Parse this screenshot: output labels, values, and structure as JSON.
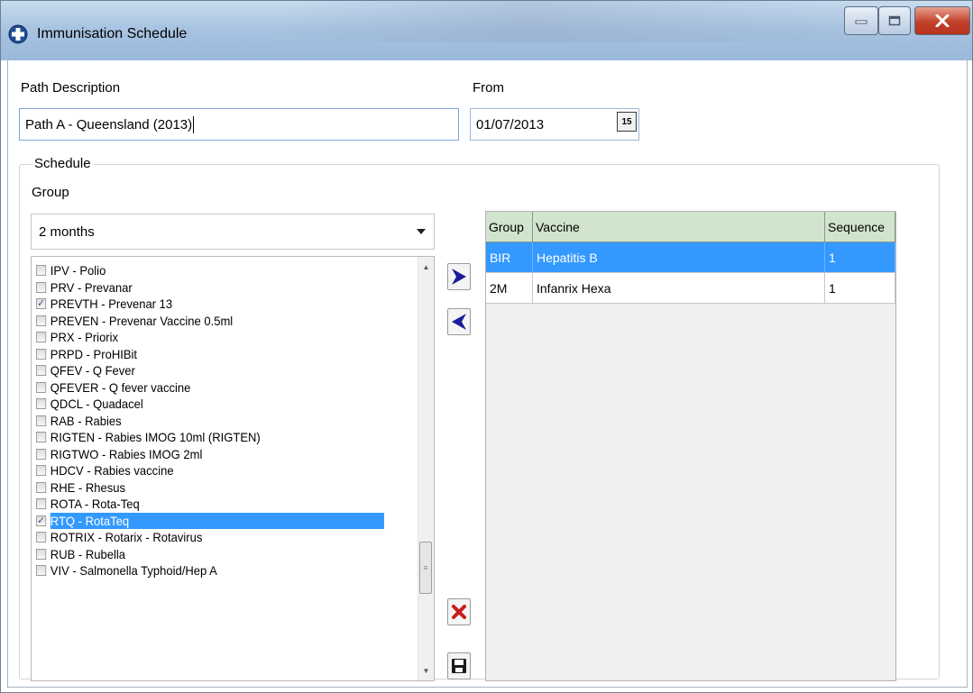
{
  "window": {
    "title": "Immunisation Schedule",
    "icon": "app-icon",
    "controls": [
      "minimize-icon",
      "maximize-icon",
      "close-icon"
    ]
  },
  "form": {
    "path_description_label": "Path Description",
    "path_description_value": "Path A - Queensland (2013)",
    "from_label": "From",
    "from_value": "01/07/2013",
    "calendar_button_text": "15"
  },
  "schedule": {
    "title": "Schedule",
    "group_label": "Group",
    "group_selected": "2 months",
    "vaccine_list": [
      {
        "label": "IPV - Polio",
        "checked": false,
        "selected": false
      },
      {
        "label": "PRV - Prevanar",
        "checked": false,
        "selected": false
      },
      {
        "label": "PREVTH - Prevenar 13",
        "checked": true,
        "selected": false
      },
      {
        "label": "PREVEN - Prevenar Vaccine 0.5ml",
        "checked": false,
        "selected": false
      },
      {
        "label": "PRX - Priorix",
        "checked": false,
        "selected": false
      },
      {
        "label": "PRPD - ProHIBit",
        "checked": false,
        "selected": false
      },
      {
        "label": "QFEV - Q Fever",
        "checked": false,
        "selected": false
      },
      {
        "label": "QFEVER - Q fever vaccine",
        "checked": false,
        "selected": false
      },
      {
        "label": "QDCL - Quadacel",
        "checked": false,
        "selected": false
      },
      {
        "label": "RAB - Rabies",
        "checked": false,
        "selected": false
      },
      {
        "label": "RIGTEN - Rabies IMOG 10ml (RIGTEN)",
        "checked": false,
        "selected": false
      },
      {
        "label": "RIGTWO - Rabies IMOG 2ml",
        "checked": false,
        "selected": false
      },
      {
        "label": "HDCV - Rabies vaccine",
        "checked": false,
        "selected": false
      },
      {
        "label": "RHE - Rhesus",
        "checked": false,
        "selected": false
      },
      {
        "label": "ROTA - Rota-Teq",
        "checked": false,
        "selected": false
      },
      {
        "label": "RTQ - RotaTeq",
        "checked": true,
        "selected": true
      },
      {
        "label": "ROTRIX - Rotarix - Rotavirus",
        "checked": false,
        "selected": false
      },
      {
        "label": "RUB - Rubella",
        "checked": false,
        "selected": false
      },
      {
        "label": "VIV - Salmonella Typhoid/Hep A",
        "checked": false,
        "selected": false
      }
    ],
    "grid": {
      "columns": [
        "Group",
        "Vaccine",
        "Sequence"
      ],
      "rows": [
        {
          "group": "BIR",
          "vaccine": "Hepatitis B",
          "sequence": "1",
          "selected": true
        },
        {
          "group": "2M",
          "vaccine": "Infanrix Hexa",
          "sequence": "1",
          "selected": false
        }
      ]
    }
  },
  "colors": {
    "selection": "#3399ff",
    "grid_header": "#d1e4cd",
    "arrow_right": "#1b1b9c",
    "arrow_left": "#1b1b9c",
    "delete_icon": "#c81e1e"
  }
}
